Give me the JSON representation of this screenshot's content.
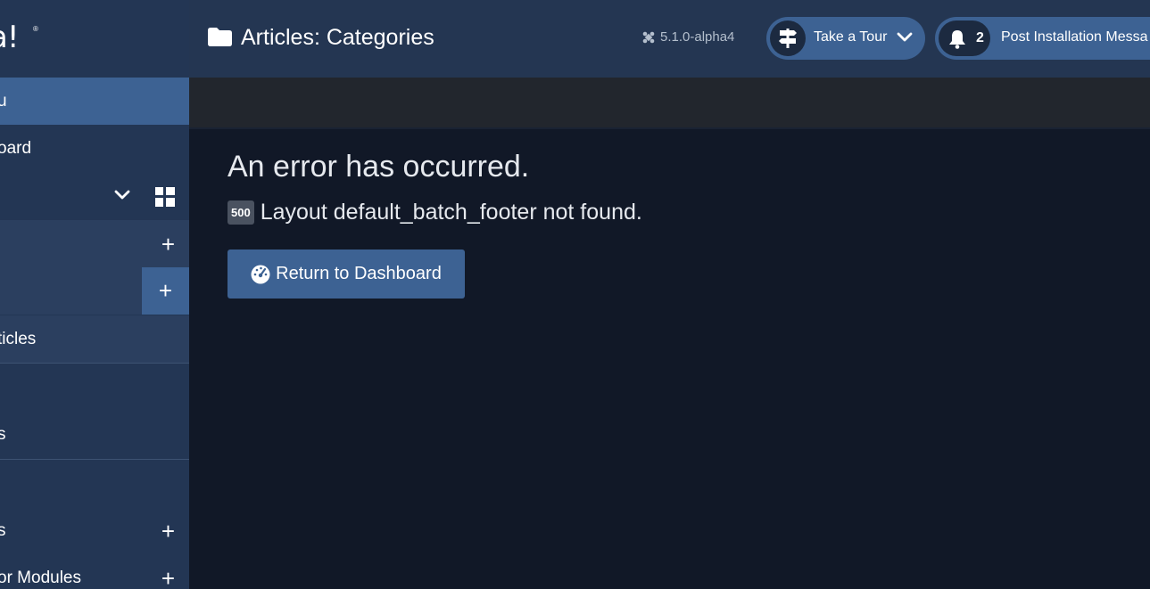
{
  "sidebar": {
    "logo_text": "a!",
    "logo_mark": "®",
    "items": [
      {
        "label": "u"
      },
      {
        "label": "oard"
      },
      {
        "label": ""
      },
      {
        "label": ""
      },
      {
        "label": ""
      },
      {
        "label": "ticles"
      },
      {
        "label": "s"
      },
      {
        "label": "s"
      },
      {
        "label": "or Modules"
      }
    ],
    "plus": "+"
  },
  "header": {
    "title": "Articles: Categories",
    "version": "5.1.0-alpha4",
    "tour_label": "Take a Tour",
    "post_count": "2",
    "post_label": "Post Installation Messa"
  },
  "error": {
    "title": "An error has occurred.",
    "code": "500",
    "message": "Layout default_batch_footer not found.",
    "button_label": "Return to Dashboard"
  }
}
